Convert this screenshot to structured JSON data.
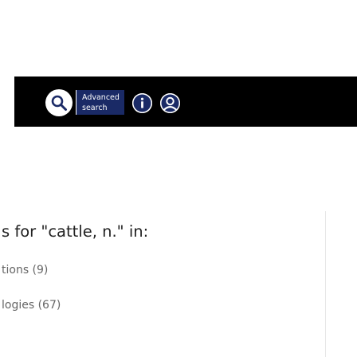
{
  "header": {
    "bar_color": "#000000",
    "advanced_search": {
      "line1": "Advanced",
      "line2": "search"
    },
    "icons": [
      "search-icon",
      "info-icon",
      "user-icon"
    ]
  },
  "results": {
    "title": "s for \"cattle, n.\" in:",
    "facets": [
      {
        "label": "tions (9)"
      },
      {
        "label": "logies (67)"
      }
    ]
  },
  "colors": {
    "accent": "#1a2a66",
    "text": "#222222",
    "muted": "#666666"
  }
}
